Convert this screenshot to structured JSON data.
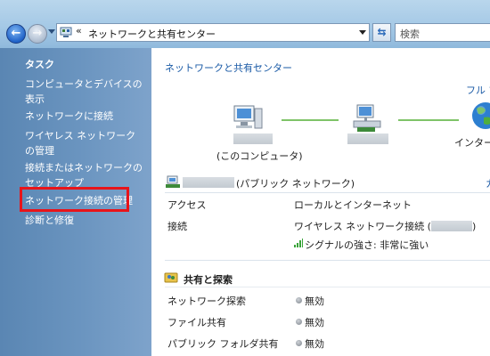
{
  "address_bar": {
    "chevron": "«",
    "path": "ネットワークと共有センター",
    "refresh_icon": "refresh-icon"
  },
  "search": {
    "placeholder": "検索"
  },
  "sidebar": {
    "title": "タスク",
    "items": [
      {
        "label": "コンピュータとデバイスの表示"
      },
      {
        "label": "ネットワークに接続"
      },
      {
        "label": "ワイヤレス ネットワークの管理"
      },
      {
        "label": "接続またはネットワークのセットアップ"
      },
      {
        "label": "ネットワーク接続の管理",
        "highlighted": true
      },
      {
        "label": "診断と修復"
      }
    ]
  },
  "main": {
    "title": "ネットワークと共有センター",
    "full_map_link": "フル マ",
    "map": {
      "this_computer_label": "(このコンピュータ)",
      "internet_label": "インター"
    },
    "network": {
      "name_suffix": "(パブリック ネットワーク)",
      "customize_link": "カ",
      "rows": [
        {
          "label": "アクセス",
          "value": "ローカルとインターネット"
        },
        {
          "label": "接続",
          "value": "ワイヤレス ネットワーク接続 (",
          "value_end": ")"
        }
      ],
      "signal_text": "シグナルの強さ: 非常に強い"
    },
    "sharing": {
      "title": "共有と探索",
      "rows": [
        {
          "label": "ネットワーク探索",
          "status": "無効"
        },
        {
          "label": "ファイル共有",
          "status": "無効"
        },
        {
          "label": "パブリック フォルダ共有",
          "status": "無効"
        }
      ]
    }
  },
  "colors": {
    "link": "#1a5aa6",
    "highlight_border": "#e8141a",
    "sidebar": "#5a86b3",
    "map_link": "#7fc468"
  }
}
